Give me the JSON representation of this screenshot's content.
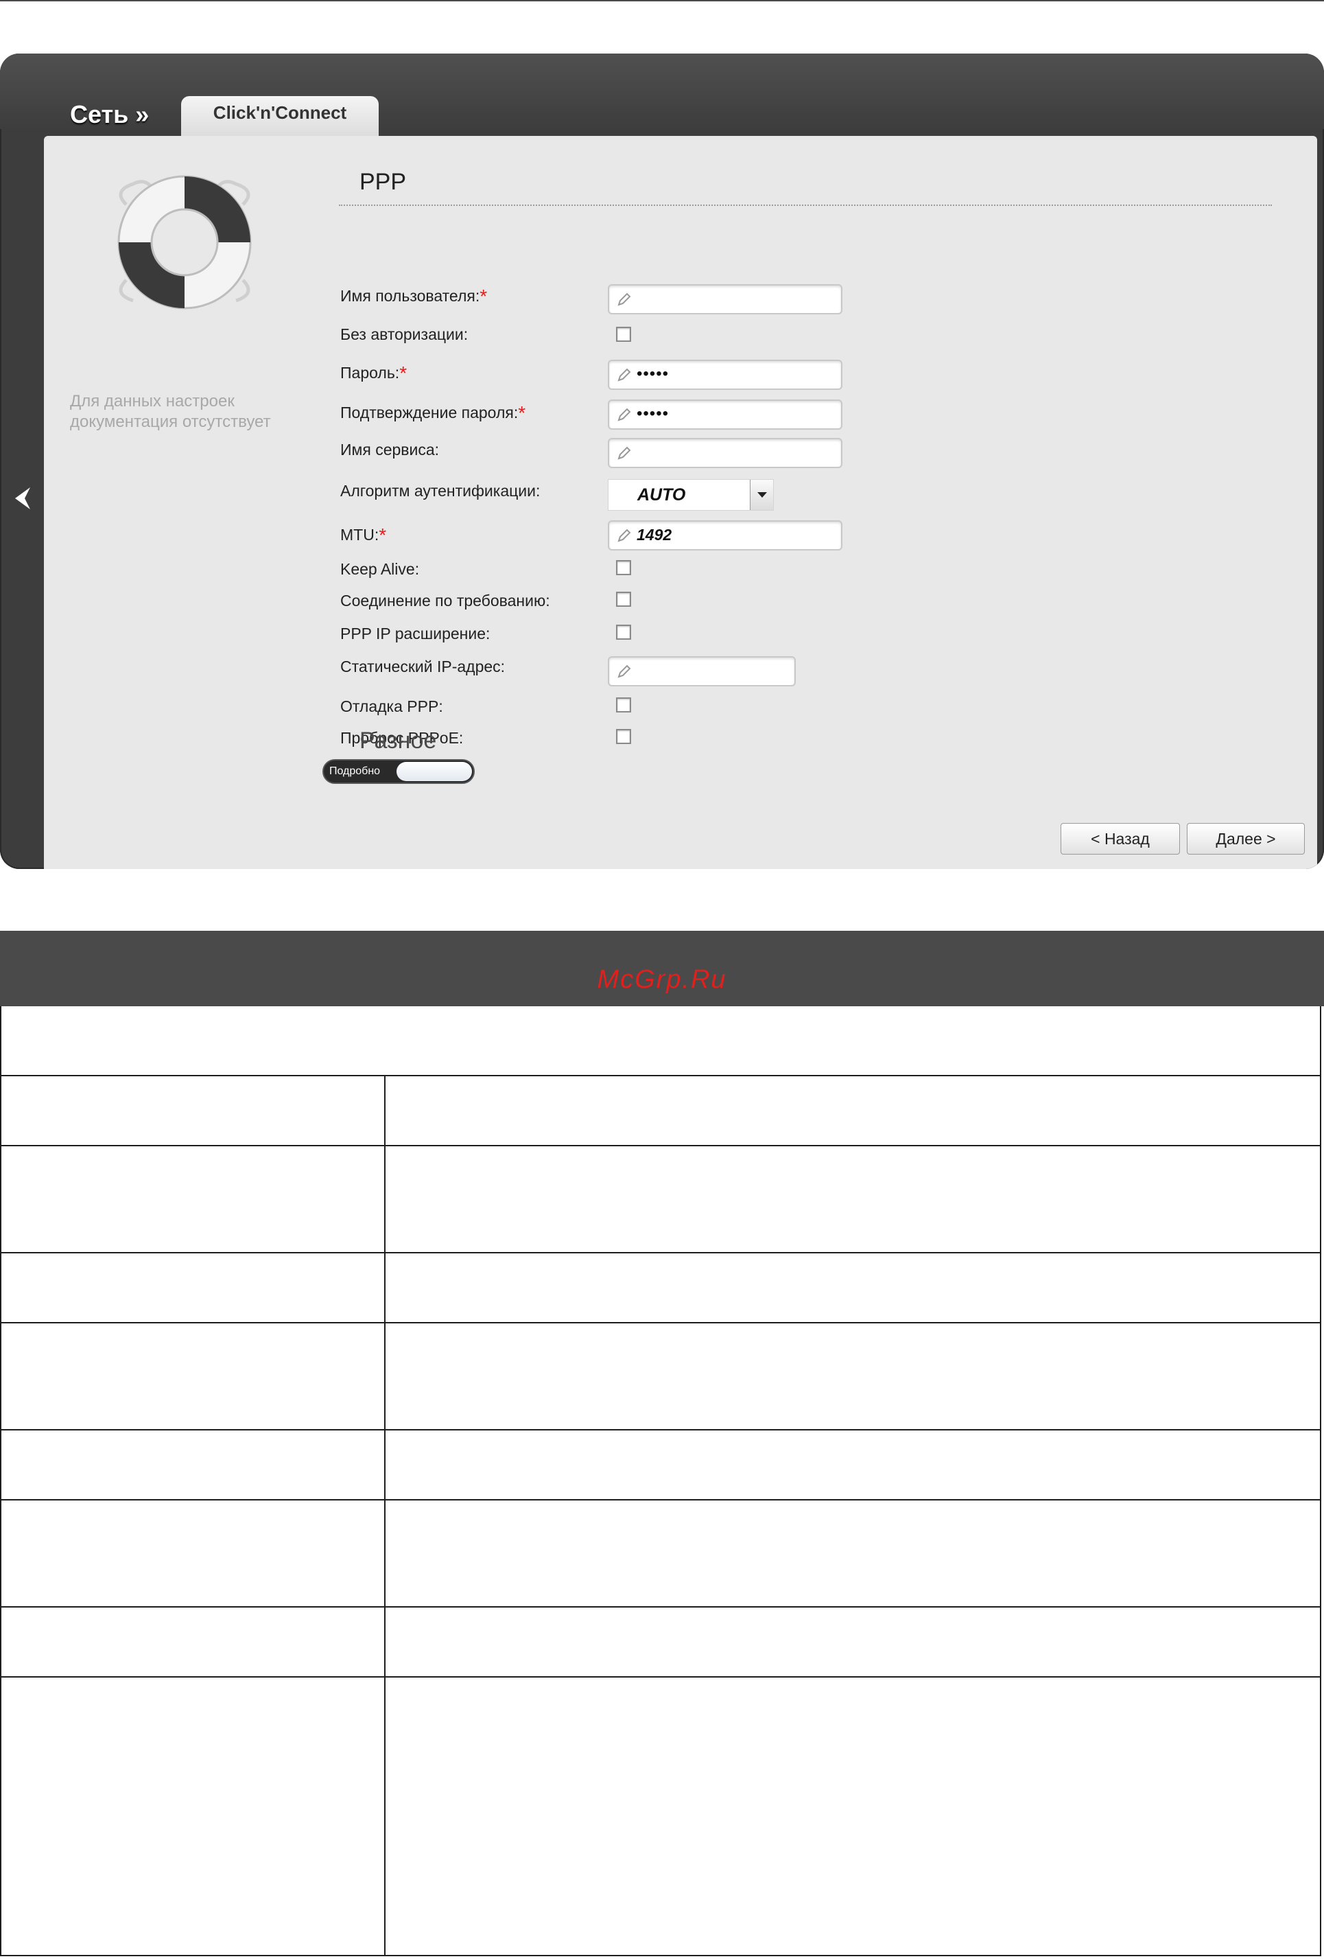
{
  "breadcrumb": {
    "section": "Сеть »",
    "tab": "Click'n'Connect"
  },
  "help": {
    "text": "Для данных настроек документация отсутствует"
  },
  "ppp": {
    "title": "PPP",
    "username_label": "Имя пользователя:",
    "noauth_label": "Без авторизации:",
    "password_label": "Пароль:",
    "password_value": "•••••",
    "password_confirm_label": "Подтверждение пароля:",
    "password_confirm_value": "•••••",
    "service_label": "Имя сервиса:",
    "auth_label": "Алгоритм аутентификации:",
    "auth_value": "AUTO",
    "mtu_label": "MTU:",
    "mtu_value": "1492",
    "keepalive_label": "Keep Alive:",
    "ondemand_label": "Соединение по требованию:",
    "ipext_label": "PPP IP расширение:",
    "staticip_label": "Статический IP-адрес:",
    "debug_label": "Отладка PPP:",
    "passthrough_label": "Проброс PPPoE:",
    "required_mark": "*"
  },
  "misc": {
    "title": "Разное",
    "toggle_label": "Подробно"
  },
  "buttons": {
    "back": "< Назад",
    "next": "Далее >"
  },
  "table": {
    "watermark": "McGrp.Ru"
  },
  "colors": {
    "frame": "#3d3d3d",
    "panel": "#e8e8e8",
    "required": "#e02020",
    "table_header": "#4a4a4a",
    "watermark": "#e0201c"
  }
}
